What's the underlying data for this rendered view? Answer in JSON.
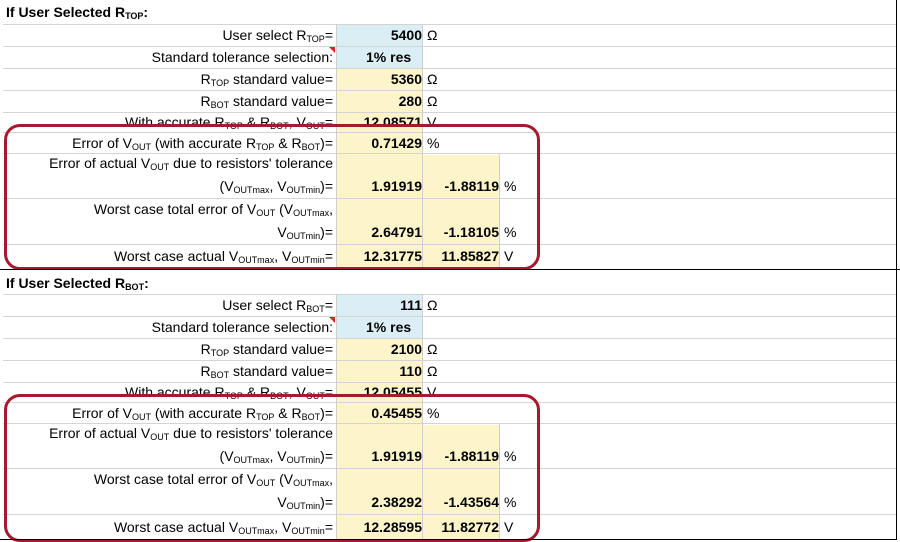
{
  "sections": [
    {
      "header": {
        "prefix": "If User Selected R",
        "sub": "TOP",
        "suffix": ":"
      },
      "user_select": {
        "pre": "User select R",
        "sub": "TOP",
        "post": "=",
        "value": "5400",
        "unit": "Ω"
      },
      "tolerance": {
        "label": "Standard tolerance selection:",
        "value": "1% res"
      },
      "rtop_std": {
        "pre": "R",
        "sub": "TOP",
        "post": " standard value=",
        "value": "5360",
        "unit": "Ω"
      },
      "rbot_std": {
        "pre": "R",
        "sub": "BOT",
        "post": " standard value=",
        "value": "280",
        "unit": "Ω"
      },
      "vout_accurate": {
        "t1": "With accurate R",
        "s1": "TOP",
        "t2": " & R",
        "s2": "BOT",
        "t3": ", V",
        "s3": "OUT",
        "t4": "=",
        "value": "12.08571",
        "unit": "V"
      },
      "error_vout": {
        "t1": "Error of V",
        "s1": "OUT",
        "t2": " (with accurate R",
        "s2": "TOP",
        "t3": " & R",
        "s3": "BOT",
        "t4": ")=",
        "value": "0.71429",
        "unit": "%"
      },
      "error_actual": {
        "line1_pre": "Error of actual V",
        "line1_sub": "OUT",
        "line1_post": " due to resistors' tolerance",
        "line2_a": "(V",
        "line2_s1": "OUTmax",
        "line2_b": ", V",
        "line2_s2": "OUTmin",
        "line2_c": ")=",
        "value_max": "1.91919",
        "value_min": "-1.88119",
        "unit": "%"
      },
      "worst_total": {
        "line1_pre": "Worst case total error of V",
        "line1_sub": "OUT",
        "line1_mid": " (V",
        "line1_sub2": "OUTmax",
        "line1_post": ",",
        "line2_a": "V",
        "line2_s": "OUTmin",
        "line2_b": ")=",
        "value_max": "2.64791",
        "value_min": "-1.18105",
        "unit": "%"
      },
      "worst_actual": {
        "t1": "Worst case actual V",
        "s1": "OUTmax",
        "t2": ", V",
        "s2": "OUTmin",
        "t3": "=",
        "value_max": "12.31775",
        "value_min": "11.85827",
        "unit": "V"
      }
    },
    {
      "header": {
        "prefix": "If User Selected R",
        "sub": "BOT",
        "suffix": ":"
      },
      "user_select": {
        "pre": "User select R",
        "sub": "BOT",
        "post": "=",
        "value": "111",
        "unit": "Ω"
      },
      "tolerance": {
        "label": "Standard tolerance selection:",
        "value": "1% res"
      },
      "rtop_std": {
        "pre": "R",
        "sub": "TOP",
        "post": " standard value=",
        "value": "2100",
        "unit": "Ω"
      },
      "rbot_std": {
        "pre": "R",
        "sub": "BOT",
        "post": " standard value=",
        "value": "110",
        "unit": "Ω"
      },
      "vout_accurate": {
        "t1": "With accurate R",
        "s1": "TOP",
        "t2": " & R",
        "s2": "BOT",
        "t3": ", V",
        "s3": "OUT",
        "t4": "=",
        "value": "12.05455",
        "unit": "V"
      },
      "error_vout": {
        "t1": "Error of V",
        "s1": "OUT",
        "t2": " (with accurate R",
        "s2": "TOP",
        "t3": " & R",
        "s3": "BOT",
        "t4": ")=",
        "value": "0.45455",
        "unit": "%"
      },
      "error_actual": {
        "line1_pre": "Error of actual V",
        "line1_sub": "OUT",
        "line1_post": " due to resistors' tolerance",
        "line2_a": "(V",
        "line2_s1": "OUTmax",
        "line2_b": ", V",
        "line2_s2": "OUTmin",
        "line2_c": ")=",
        "value_max": "1.91919",
        "value_min": "-1.88119",
        "unit": "%"
      },
      "worst_total": {
        "line1_pre": "Worst case total error of V",
        "line1_sub": "OUT",
        "line1_mid": " (V",
        "line1_sub2": "OUTmax",
        "line1_post": ",",
        "line2_a": "V",
        "line2_s": "OUTmin",
        "line2_b": ")=",
        "value_max": "2.38292",
        "value_min": "-1.43564",
        "unit": "%"
      },
      "worst_actual": {
        "t1": "Worst case actual V",
        "s1": "OUTmax",
        "t2": ", V",
        "s2": "OUTmin",
        "t3": "=",
        "value_max": "12.28595",
        "value_min": "11.82772",
        "unit": "V"
      }
    }
  ],
  "colors": {
    "input_cell": "#dbeef5",
    "computed_cell": "#fdf5c9",
    "highlight_box": "#a6192e",
    "comment_marker": "#e0221b"
  }
}
